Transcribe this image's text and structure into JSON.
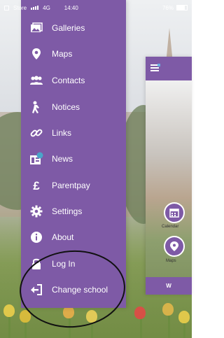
{
  "status": {
    "carrier": "Store",
    "network": "4G",
    "time": "14:40",
    "battery": "76%"
  },
  "menu": {
    "items": [
      {
        "label": "Galleries",
        "icon": "gallery-icon"
      },
      {
        "label": "Maps",
        "icon": "map-pin-icon"
      },
      {
        "label": "Contacts",
        "icon": "contacts-icon"
      },
      {
        "label": "Notices",
        "icon": "notices-icon"
      },
      {
        "label": "Links",
        "icon": "link-icon"
      },
      {
        "label": "News",
        "icon": "news-icon"
      },
      {
        "label": "Parentpay",
        "icon": "pound-icon"
      },
      {
        "label": "Settings",
        "icon": "gear-icon"
      },
      {
        "label": "About",
        "icon": "info-icon"
      },
      {
        "label": "Log In",
        "icon": "lock-icon"
      },
      {
        "label": "Change school",
        "icon": "logout-icon"
      }
    ]
  },
  "preview": {
    "calendar_label": "Calendar",
    "maps_label": "Maps",
    "bottom_label": "W"
  },
  "colors": {
    "drawer": "#7e5aa6"
  }
}
